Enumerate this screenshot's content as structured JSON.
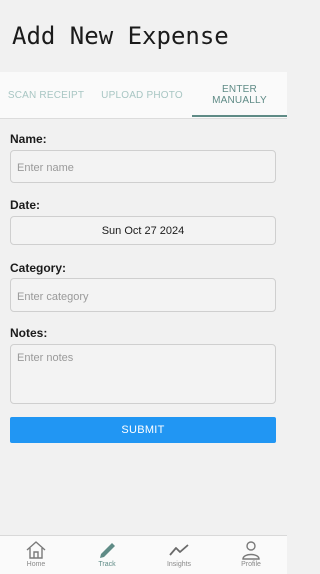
{
  "page": {
    "title": "Add New Expense"
  },
  "tabs": [
    {
      "label": "SCAN RECEIPT",
      "active": false
    },
    {
      "label": "UPLOAD PHOTO",
      "active": false
    },
    {
      "label": "ENTER\nMANUALLY",
      "active": true
    }
  ],
  "form": {
    "name": {
      "label": "Name:",
      "placeholder": "Enter name"
    },
    "date": {
      "label": "Date:",
      "value": "Sun Oct 27 2024"
    },
    "category": {
      "label": "Category:",
      "placeholder": "Enter category"
    },
    "notes": {
      "label": "Notes:",
      "placeholder": "Enter notes"
    },
    "submit_label": "SUBMIT"
  },
  "nav": [
    {
      "label": "Home",
      "icon": "home-icon",
      "active": false
    },
    {
      "label": "Track",
      "icon": "pencil-icon",
      "active": true
    },
    {
      "label": "Insights",
      "icon": "trend-icon",
      "active": false
    },
    {
      "label": "Profile",
      "icon": "person-icon",
      "active": false
    }
  ],
  "colors": {
    "accent": "#5f8b86",
    "tab_inactive": "#a8c6c3",
    "submit": "#2196f3",
    "background": "#f1f1f1"
  }
}
